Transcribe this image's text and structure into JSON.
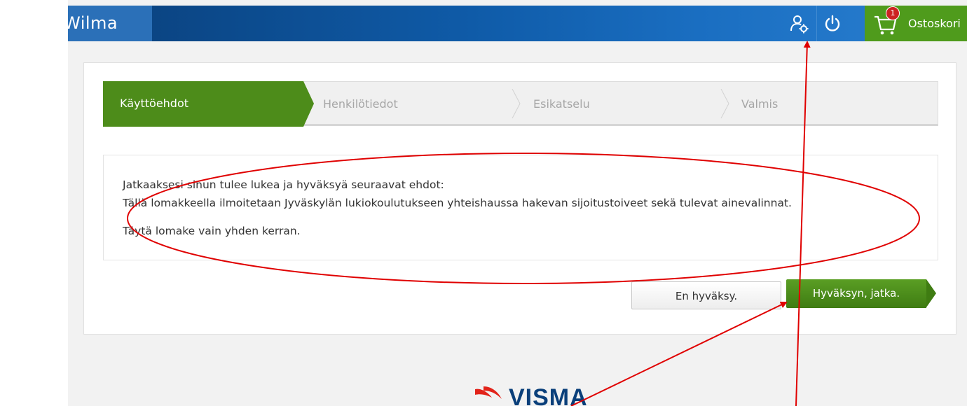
{
  "app": {
    "title": "Wilma"
  },
  "header": {
    "cart": {
      "badge": "1",
      "label": "Ostoskori"
    }
  },
  "steps": [
    {
      "label": "Käyttöehdot",
      "active": true
    },
    {
      "label": "Henkilötiedot",
      "active": false
    },
    {
      "label": "Esikatselu",
      "active": false
    },
    {
      "label": "Valmis",
      "active": false
    }
  ],
  "terms": {
    "intro": "Jatkaaksesi sinun tulee lukea ja hyväksyä seuraavat ehdot:",
    "line1": "Tällä lomakkeella ilmoitetaan Jyväskylän lukiokoulutukseen yhteishaussa hakevan sijoitustoiveet sekä tulevat ainevalinnat.",
    "line2": "Täytä lomake vain yhden kerran."
  },
  "actions": {
    "decline_label": "En hyväksy.",
    "accept_label": "Hyväksyn, jatka."
  },
  "footer": {
    "logo_text": "VISMA"
  },
  "colors": {
    "header_blue": "#0f5ba8",
    "brand_tile": "#2b70b8",
    "accent_green": "#4d8c1a",
    "cart_green": "#4f9b1c",
    "annotation_red": "#e00000"
  },
  "icons": {
    "settings": "user-settings-icon",
    "power": "power-icon",
    "cart": "shopping-cart-icon"
  }
}
